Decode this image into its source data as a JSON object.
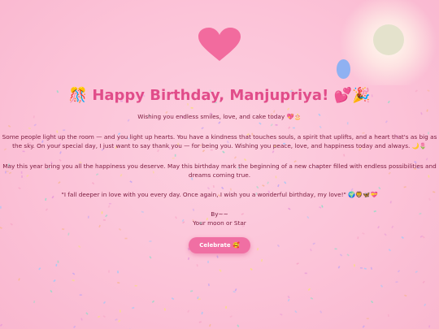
{
  "header": {
    "title_prefix_emoji": "🎊",
    "title": "Happy Birthday, Manjupriya!",
    "title_suffix_emoji": "💕🎉"
  },
  "message": {
    "subtitle": "Wishing you endless smiles, love, and cake today 💖🎂",
    "paragraph_1": "Some people light up the room — and you light up hearts. You have a kindness that touches souls, a spirit that uplifts, and a heart that's as big as the sky. On your special day, I just want to say thank you — for being you. Wishing you peace, love, and happiness today and always. 🌙🌷",
    "paragraph_2": "May this year bring you all the happiness you deserve. May this birthday mark the beginning of a new chapter filled with endless possibilities and dreams coming true.",
    "quote": "\"I fall deeper in love with you every day. Once again, I wish you a wonderful birthday, my love!\" 🌍🦁🦋💝",
    "signoff": "By~~",
    "signature": "Your moon or Star"
  },
  "actions": {
    "celebrate_label": "Celebrate 🥰"
  },
  "colors": {
    "background": "#fcc3d8",
    "title": "#e14d8a",
    "text": "#7a1b3e",
    "button": "#f06fa3",
    "heart": "#f26b9e",
    "balloon": "#8fb1f2",
    "moon": "#e4e2cc"
  },
  "decorations": {
    "icons": [
      "heart-icon",
      "moon-icon",
      "balloon-icon",
      "confetti"
    ]
  }
}
